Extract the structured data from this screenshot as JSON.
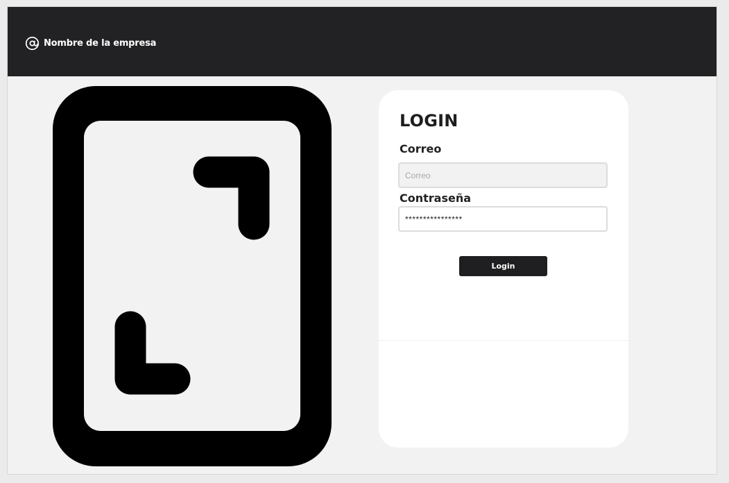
{
  "header": {
    "brand_icon": "at-sign-icon",
    "company_name": "Nombre de la empresa"
  },
  "illustration": {
    "icon": "tablet-expand-icon"
  },
  "login_card": {
    "title": "LOGIN",
    "email_label": "Correo",
    "email_placeholder": "Correo",
    "email_value": "",
    "password_label": "Contraseña",
    "password_value": "****************",
    "submit_label": "Login"
  },
  "colors": {
    "header_bg": "#222224",
    "page_bg": "#f2f2f2",
    "card_bg": "#ffffff",
    "button_bg": "#1f1f21",
    "illustration": "#000000"
  }
}
